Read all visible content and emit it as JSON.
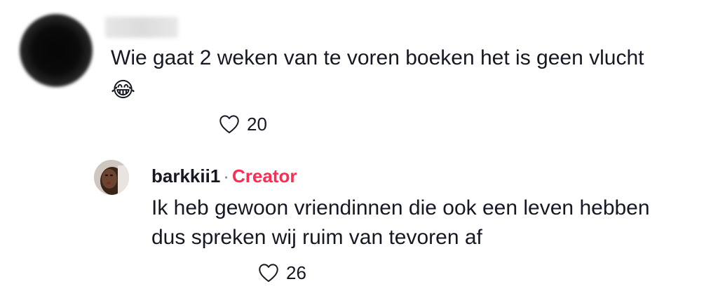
{
  "comment": {
    "username": "",
    "text": "Wie gaat 2 weken van te voren boeken het is geen vlucht",
    "emoji": "😂",
    "likes": "20"
  },
  "reply": {
    "username": "barkkii1",
    "separator": "·",
    "badge": "Creator",
    "text_line1": "Ik heb gewoon vriendinnen die ook een leven hebben",
    "text_line2": "dus spreken wij ruim van tevoren af",
    "likes": "26"
  },
  "colors": {
    "creator_badge": "#fe2c55",
    "text": "#161823",
    "icon": "#161823"
  },
  "icons": {
    "like": "heart-outline-icon"
  }
}
